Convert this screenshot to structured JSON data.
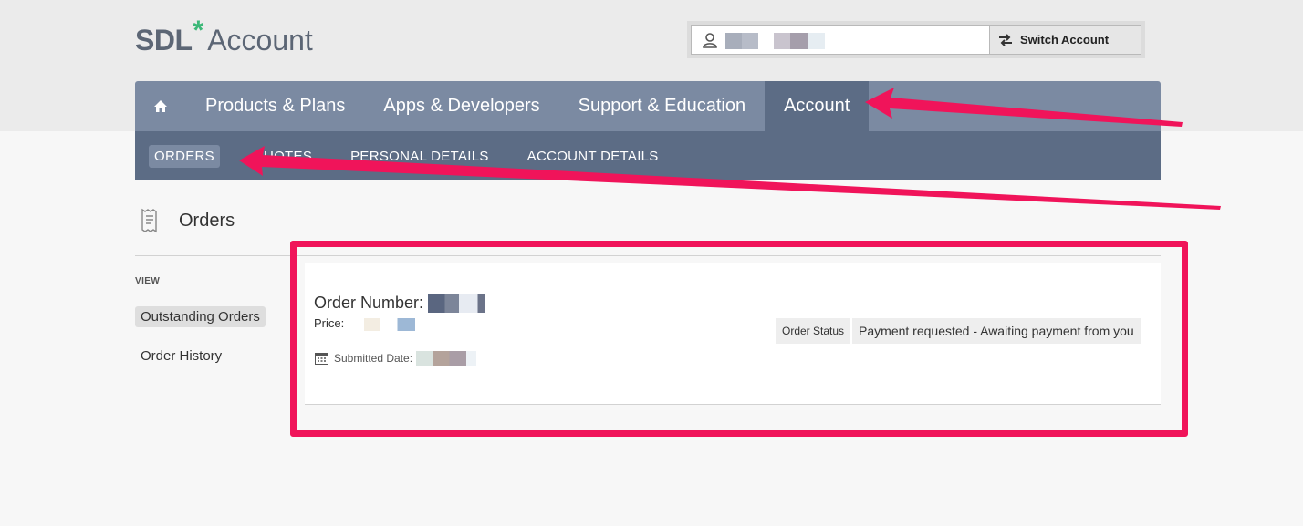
{
  "logo": {
    "brand": "SDL",
    "star": "*",
    "product": "Account"
  },
  "switcher": {
    "button_label": "Switch Account",
    "user_icon": "user-icon",
    "switch_icon": "swap-arrows-icon"
  },
  "main_nav": {
    "home_icon": "home-icon",
    "items": [
      {
        "label": "Products & Plans"
      },
      {
        "label": "Apps & Developers"
      },
      {
        "label": "Support & Education"
      },
      {
        "label": "Account",
        "active": true
      }
    ]
  },
  "sub_nav": {
    "items": [
      {
        "label": "ORDERS",
        "active": true
      },
      {
        "label": "QUOTES"
      },
      {
        "label": "PERSONAL DETAILS"
      },
      {
        "label": "ACCOUNT DETAILS"
      }
    ]
  },
  "page": {
    "title": "Orders",
    "title_icon": "receipt-icon"
  },
  "sidebar": {
    "view_label": "VIEW",
    "items": [
      {
        "label": "Outstanding Orders",
        "active": true
      },
      {
        "label": "Order History"
      }
    ]
  },
  "order": {
    "number_label": "Order Number:",
    "price_label": "Price:",
    "submitted_label": "Submitted Date:",
    "calendar_icon": "calendar-icon",
    "status_label": "Order Status",
    "status_value": "Payment requested - Awaiting payment from you"
  },
  "colors": {
    "nav_bg": "#7b8aa2",
    "nav_active": "#5c6c85",
    "annotation": "#f0145a",
    "logo_star": "#3cb878"
  }
}
